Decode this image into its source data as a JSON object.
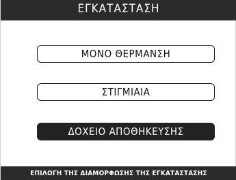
{
  "header": {
    "title": "ΕΓΚΑΤΑΣΤΑΣΗ"
  },
  "menu": {
    "options": [
      {
        "label": "ΜΟΝΟ ΘΕΡΜΑΝΣΗ",
        "selected": false
      },
      {
        "label": "ΣΤΙΓΜΙΑΙΑ",
        "selected": false
      },
      {
        "label": "ΔΟΧΕΙΟ ΑΠΟΘΗΚΕΥΣΗΣ",
        "selected": true
      }
    ]
  },
  "footer": {
    "hint": "ΕΠΙΛΟΓΗ ΤΗΣ ΔΙΑΜΟΡΦΩΣΗΣ ΤΗΣ ΕΓΚΑΤΑΣΤΑΣΗΣ"
  },
  "colors": {
    "bar_background": "#2b2b2b",
    "selected_background": "#222222",
    "text_light": "#ffffff",
    "text_dark": "#111111"
  }
}
